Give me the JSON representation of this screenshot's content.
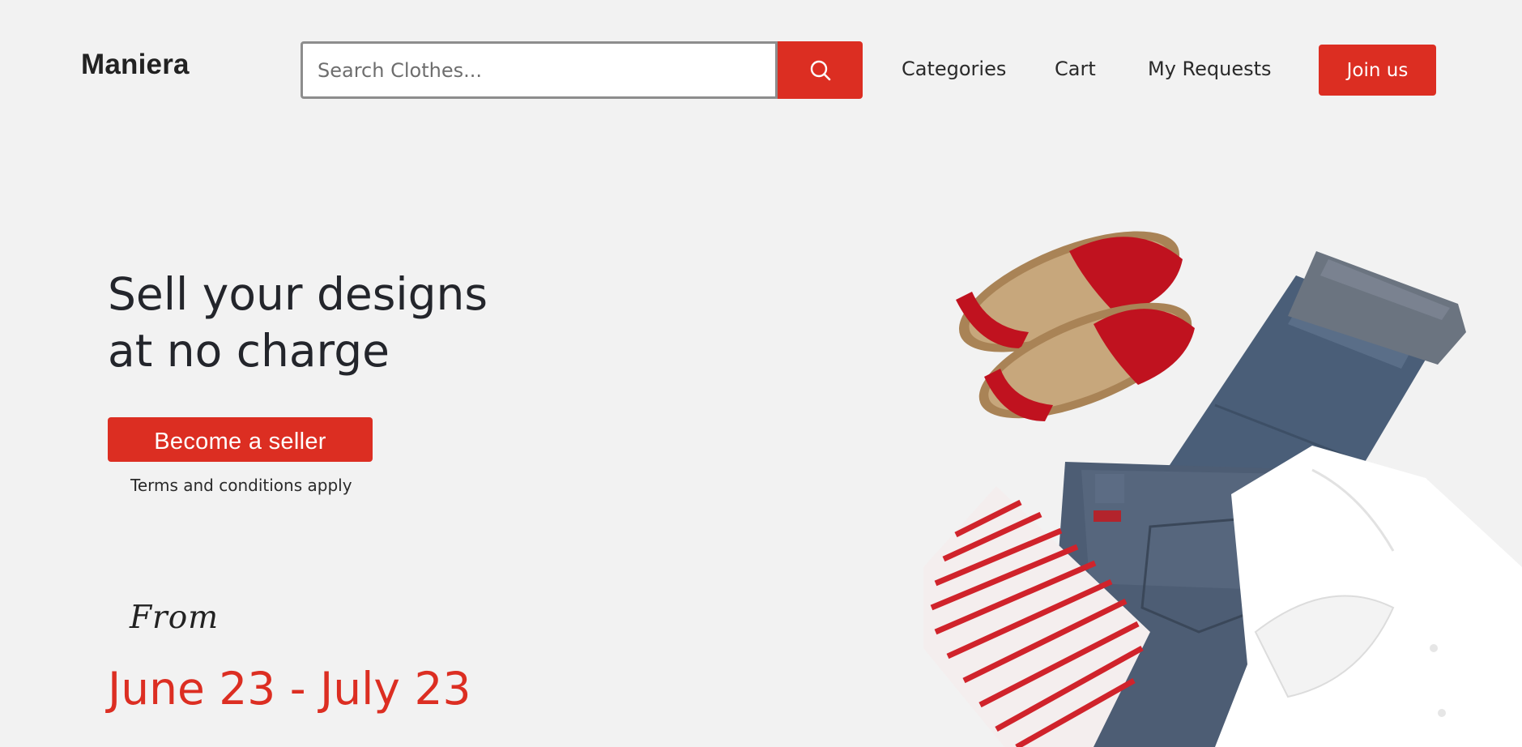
{
  "header": {
    "logo": "Maniera",
    "search": {
      "placeholder": "Search Clothes...",
      "value": "",
      "button_icon": "search-icon"
    },
    "nav": [
      {
        "label": "Categories"
      },
      {
        "label": "Cart"
      },
      {
        "label": "My Requests"
      }
    ],
    "join_label": "Join us"
  },
  "hero": {
    "headline_line1": "Sell your designs",
    "headline_line2": "at no charge",
    "cta_label": "Become a seller",
    "terms_note": "Terms and conditions apply",
    "from_label": "From",
    "date_range": "June 23 - July 23",
    "image_content": [
      "red-sandals",
      "denim-jeans",
      "denim-jacket",
      "striped-shirt",
      "white-shirt"
    ]
  },
  "colors": {
    "accent": "#dc2e22",
    "background": "#f2f2f2",
    "text": "#23252b"
  }
}
